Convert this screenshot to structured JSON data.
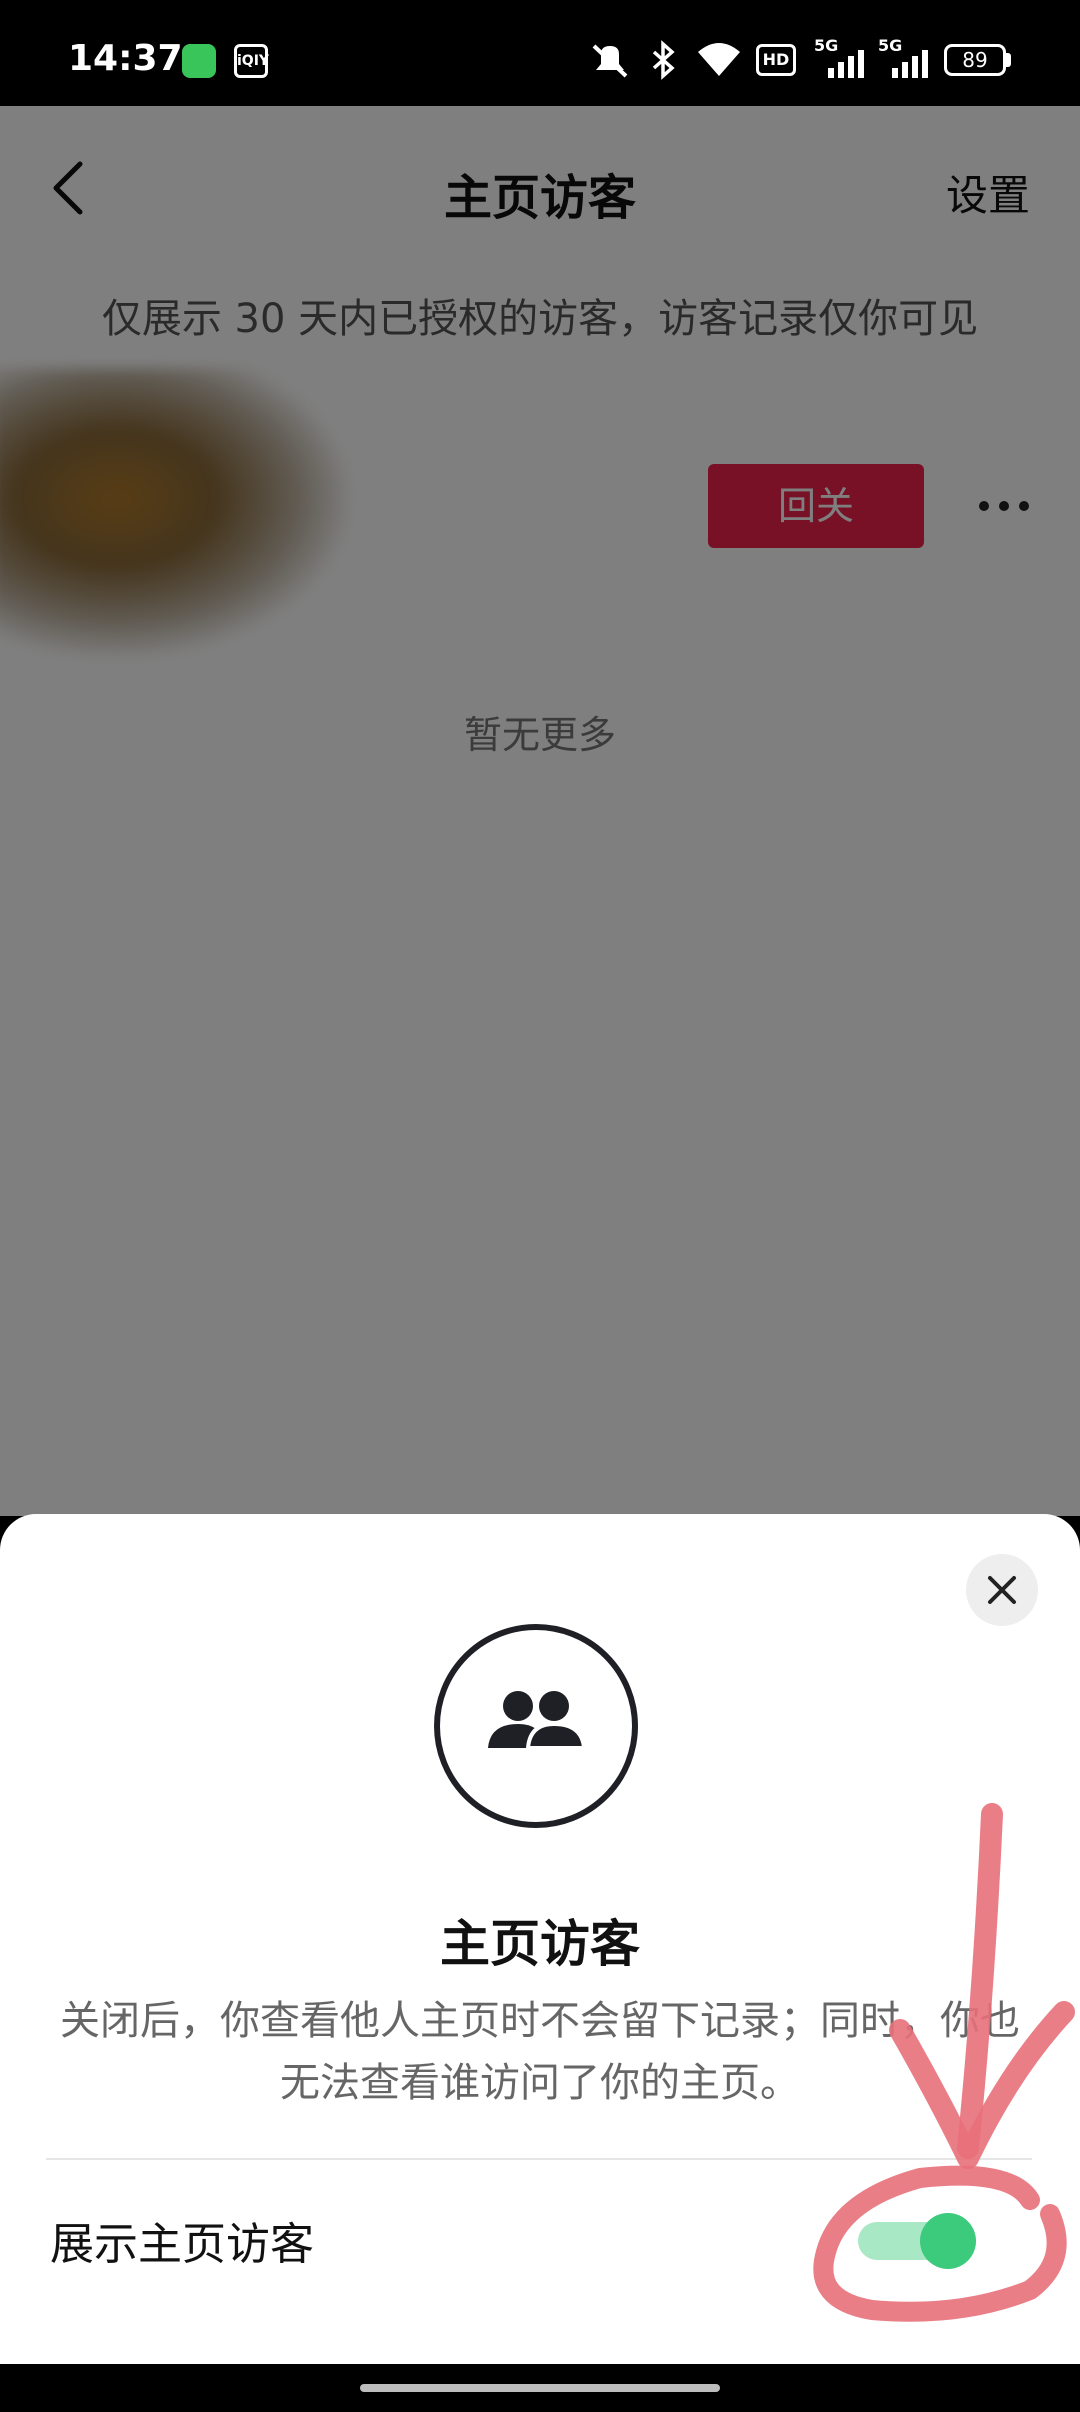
{
  "status_bar": {
    "time": "14:37",
    "icons": [
      "message-app-icon",
      "iqiyi-app-icon",
      "mute-icon",
      "bluetooth-icon",
      "wifi-icon",
      "hd-icon",
      "5g-signal-icon",
      "5g-signal-icon"
    ],
    "iqiyi_text": "iQIY",
    "hd_label": "HD",
    "network_label": "5G",
    "battery": "89"
  },
  "header": {
    "title": "主页访客",
    "settings_label": "设置"
  },
  "notice": "仅展示 30 天内已授权的访客，访客记录仅你可见",
  "visitor": {
    "follow_back_label": "回关"
  },
  "no_more_text": "暂无更多",
  "sheet": {
    "title": "主页访客",
    "description": "关闭后，你查看他人主页时不会留下记录；同时，你也无法查看谁访问了你的主页。",
    "toggle_label": "展示主页访客",
    "toggle_on": true
  },
  "colors": {
    "accent_red": "#f0204c",
    "toggle_green": "#3cca7c",
    "annotation_red": "#e8707a"
  }
}
